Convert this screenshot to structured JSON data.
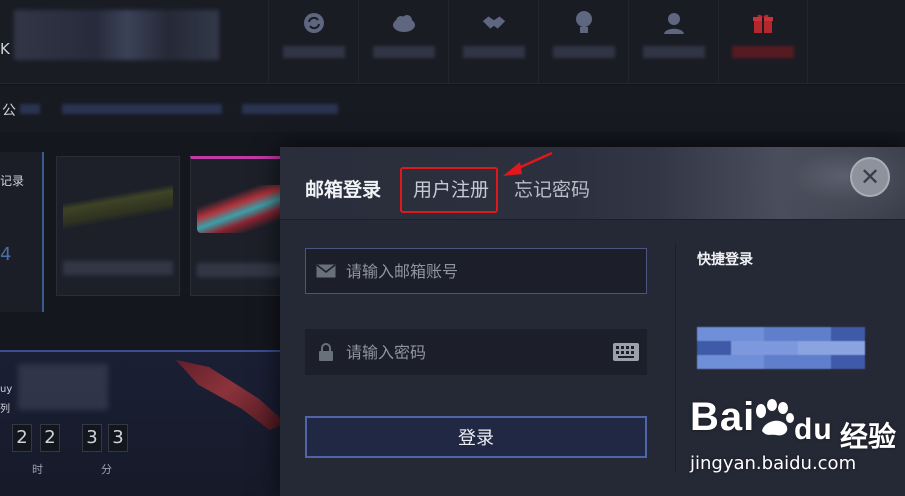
{
  "header": {
    "brand_char": "K",
    "nav_icons": [
      "refresh-icon",
      "cloud-icon",
      "handshake-icon",
      "lightbulb-icon",
      "user-badge-icon",
      "gift-icon"
    ]
  },
  "notice": {
    "char": "公"
  },
  "left_panel": {
    "text": "记录",
    "number": "4"
  },
  "countdown": {
    "hours_digits": [
      "2",
      "2"
    ],
    "minutes_digits": [
      "3",
      "3"
    ],
    "hours_label": "时",
    "minutes_label": "分",
    "side_text": [
      "uy",
      "列"
    ]
  },
  "login_modal": {
    "tabs": {
      "email_login": "邮箱登录",
      "register": "用户注册",
      "forgot_password": "忘记密码"
    },
    "close_symbol": "✕",
    "email_placeholder": "请输入邮箱账号",
    "email_value": "",
    "password_placeholder": "请输入密码",
    "password_value": "",
    "login_button": "登录",
    "quick_login_title": "快捷登录"
  },
  "annotation": {
    "highlight_color": "#e0181b"
  },
  "watermark": {
    "main_prefix": "Bai",
    "main_suffix": "du",
    "cn": "经验",
    "url": "jingyan.baidu.com"
  },
  "colors": {
    "accent_blue": "#4f65a8",
    "modal_bg": "#252936",
    "gift_red": "#b2282d"
  }
}
